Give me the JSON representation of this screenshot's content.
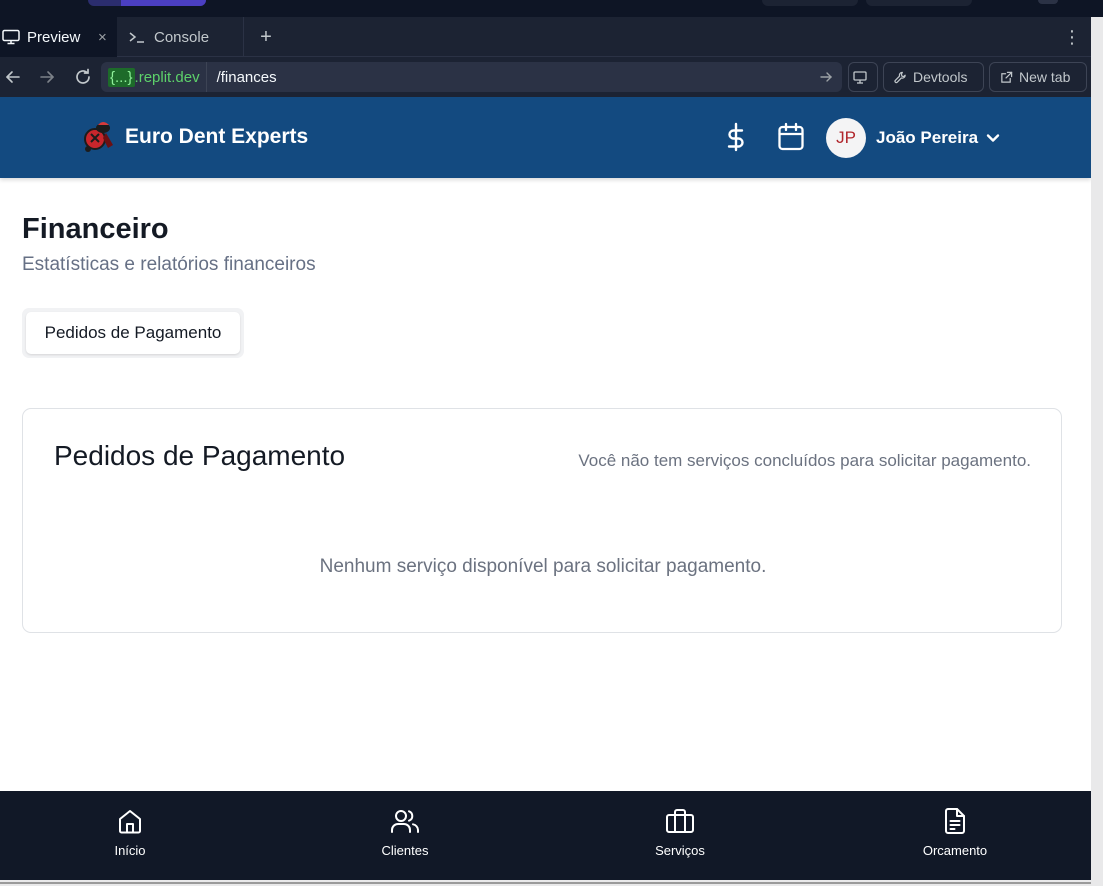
{
  "chrome": {
    "tabs": [
      {
        "label": "Preview",
        "active": true
      },
      {
        "label": "Console",
        "active": false
      }
    ],
    "close_symbol": "×",
    "add_tab_symbol": "+",
    "menu_symbol": "⋮",
    "url": {
      "host_brace": "{...}",
      "host_domain": ".replit.dev",
      "path": "/finances"
    },
    "devtools_label": "Devtools",
    "new_tab_label": "New tab"
  },
  "header": {
    "brand_name": "Euro Dent Experts",
    "user": {
      "initials": "JP",
      "name": "João Pereira"
    },
    "colors": {
      "header_bg": "#134a80",
      "avatar_text": "#b0252b"
    }
  },
  "page": {
    "title": "Financeiro",
    "subtitle": "Estatísticas e relatórios financeiros",
    "tabs": [
      {
        "label": "Pedidos de Pagamento",
        "active": true
      }
    ]
  },
  "card": {
    "title": "Pedidos de Pagamento",
    "description": "Você não tem serviços concluídos para solicitar pagamento.",
    "empty_message": "Nenhum serviço disponível para solicitar pagamento."
  },
  "bottom_nav": {
    "items": [
      {
        "label": "Início",
        "icon": "home-icon"
      },
      {
        "label": "Clientes",
        "icon": "users-icon"
      },
      {
        "label": "Serviços",
        "icon": "briefcase-icon"
      },
      {
        "label": "Orcamento",
        "icon": "file-text-icon"
      }
    ]
  }
}
